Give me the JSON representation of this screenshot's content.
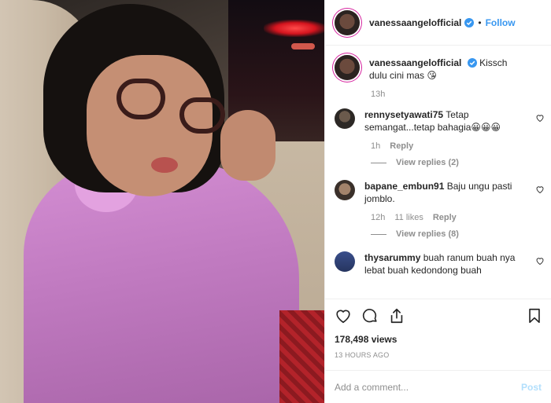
{
  "header": {
    "username": "vanessaangelofficial",
    "dot": "•",
    "follow_label": "Follow"
  },
  "caption": {
    "username": "vanessaangelofficial",
    "text": "Kissch dulu cini mas 😘",
    "time": "13h"
  },
  "comments": [
    {
      "username": "rennysetyawati75",
      "text": "Tetap semangat...tetap bahagia😀😀😀",
      "time": "1h",
      "likes": "",
      "reply_label": "Reply",
      "view_replies": "View replies (2)"
    },
    {
      "username": "bapane_embun91",
      "text": "Baju ungu pasti jomblo.",
      "time": "12h",
      "likes": "11 likes",
      "reply_label": "Reply",
      "view_replies": "View replies (8)"
    },
    {
      "username": "thysarummy",
      "text": "buah ranum buah nya lebat buah kedondong buah",
      "time": "",
      "likes": "",
      "reply_label": "",
      "view_replies": ""
    }
  ],
  "stats": {
    "views": "178,498 views",
    "posted": "13 HOURS AGO"
  },
  "add_comment": {
    "placeholder": "Add a comment...",
    "post_label": "Post"
  },
  "colors": {
    "accent": "#3897f0",
    "verified": "#3897f0",
    "muted": "#8e8e8e",
    "post_disabled": "#b2dffc"
  }
}
